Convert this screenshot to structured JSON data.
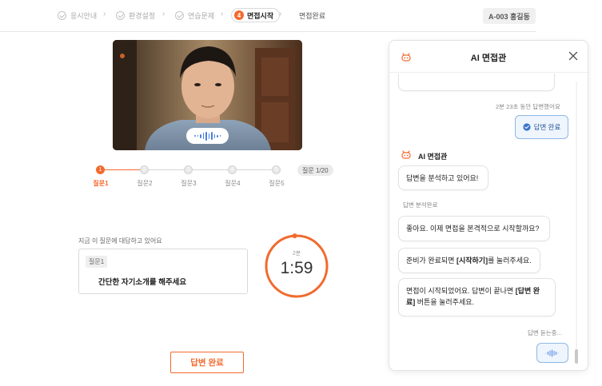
{
  "steps": [
    {
      "label": "응시안내",
      "state": "done"
    },
    {
      "label": "환경설정",
      "state": "done"
    },
    {
      "label": "연습문제",
      "state": "done"
    },
    {
      "label": "면접시작",
      "state": "active",
      "number": "4"
    },
    {
      "label": "면접완료",
      "state": "future"
    }
  ],
  "user_badge": "A-003 홍길동",
  "video": {
    "voice_indicator": "listening-waveform"
  },
  "questions": {
    "labels": [
      "질문1",
      "질문2",
      "질문3",
      "질문4",
      "질문5"
    ],
    "numbers": [
      "1",
      "2",
      "3",
      "4",
      "5"
    ],
    "current": 1,
    "count_text": "질문 1/20"
  },
  "question_box": {
    "hint": "지금 이 질문에 대답하고 있어요",
    "tag": "질문1",
    "text": "간단한 자기소개를 해주세요"
  },
  "timer": {
    "sub_label": "2분",
    "remaining": "1:59",
    "progress_fraction": 0.99,
    "color": "#f26a2e"
  },
  "submit_button": "답변 완료",
  "panel": {
    "title": "AI 면접관",
    "close_icon": "close-icon",
    "answered_meta": "2분 23초 동안 답변했어요",
    "user_answer_label": "답변 완료",
    "bot_name": "AI 면접관",
    "analyzing": "답변을 분석하고 있어요!",
    "analysis_done": "답변 분석완료",
    "msg1": "좋아요. 이제 면접을 본격적으로 시작할까요?",
    "msg2_a": "준비가 완료되면 ",
    "msg2_b": "[시작하기]",
    "msg2_c": "를 눌러주세요.",
    "msg3_a": "면접이 시작되었어요. 답변이 끝나면 ",
    "msg3_b": "[답변 완료]",
    "msg3_c": " 버튼을 눌러주세요.",
    "listening": "답변 듣는중..."
  },
  "colors": {
    "accent": "#f26a2e",
    "user_bubble_border": "#8fb8e6",
    "user_bubble_bg": "#eef5fd"
  }
}
